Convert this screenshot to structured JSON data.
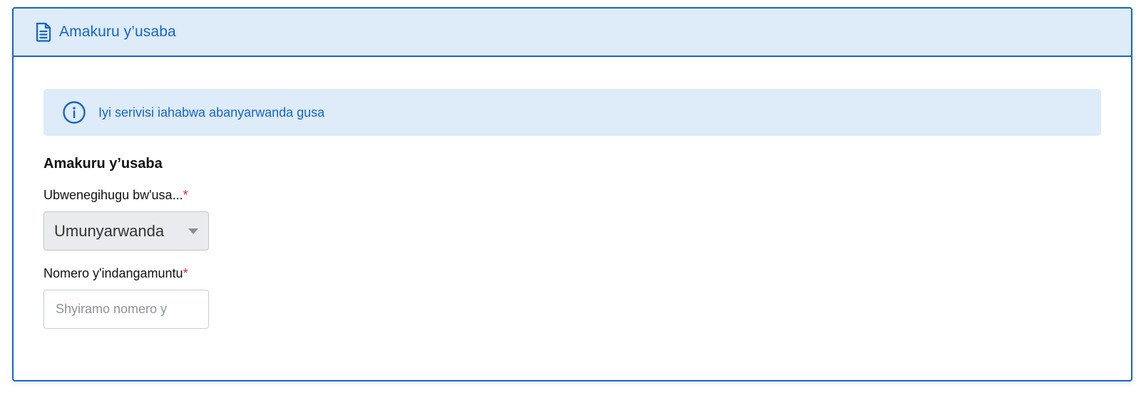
{
  "header": {
    "icon": "document-icon",
    "title": "Amakuru y’usaba"
  },
  "alert": {
    "icon": "info-icon",
    "text": "Iyi serivisi iahabwa abanyarwanda gusa"
  },
  "section": {
    "title": "Amakuru y’usaba"
  },
  "nationality": {
    "label": "Ubwenegihugu bw'usa...",
    "required_mark": "*",
    "selected_value": "Umunyarwanda"
  },
  "id_number": {
    "label": "Nomero y'indangamuntu",
    "required_mark": "*",
    "value": "",
    "placeholder": "Shyiramo nomero y"
  },
  "colors": {
    "accent": "#1565c9",
    "header_bg": "#deebf8",
    "required": "#e0202a"
  }
}
